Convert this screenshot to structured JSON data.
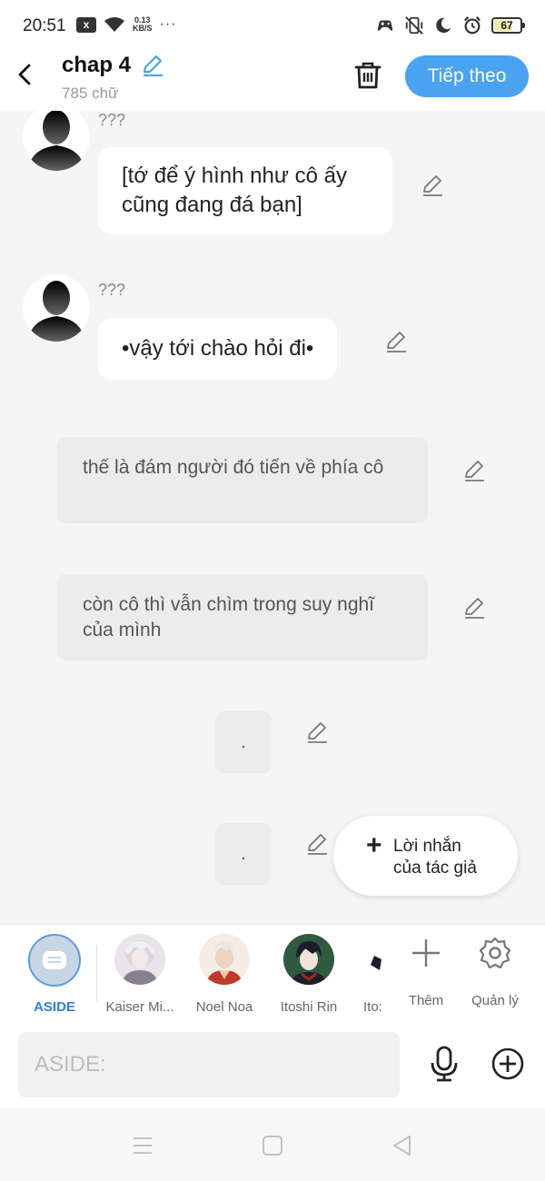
{
  "status_bar": {
    "time": "20:51",
    "notification_badge": "x",
    "net_speed_value": "0.13",
    "net_speed_unit": "KB/S",
    "more_dots": "···",
    "battery": "67"
  },
  "header": {
    "title": "chap 4",
    "word_count": "785 chữ",
    "next_label": "Tiếp theo"
  },
  "messages": [
    {
      "type": "character",
      "speaker": "???",
      "text": "[tớ để ý hình như cô ấy cũng đang đá bạn]"
    },
    {
      "type": "character",
      "speaker": "???",
      "text": "•vậy tới chào hỏi đi•"
    },
    {
      "type": "narration",
      "text": "thế là đám người đó tiến về phía cô"
    },
    {
      "type": "narration",
      "text": "còn cô thì vẫn chìm trong suy nghĩ của mình"
    },
    {
      "type": "narration",
      "text": "."
    },
    {
      "type": "narration",
      "text": "."
    }
  ],
  "fab": {
    "label": "Lời nhắn của tác giả"
  },
  "characters": [
    {
      "name": "ASIDE",
      "selected": true
    },
    {
      "name": "Kaiser Mi...",
      "avatar_colors": [
        "#d9d6dc",
        "#8a7f8f"
      ]
    },
    {
      "name": "Noel Noa",
      "avatar_colors": [
        "#ecd3c2",
        "#c0392b"
      ]
    },
    {
      "name": "Itoshi Rin",
      "avatar_colors": [
        "#2e5b3f",
        "#1a1f2b"
      ]
    },
    {
      "name": "Ito:"
    }
  ],
  "tools": {
    "add_label": "Thêm",
    "manage_label": "Quản lý"
  },
  "input": {
    "placeholder": "ASIDE:"
  },
  "colors": {
    "accent": "#4aa3f0",
    "aside_selected": "#2d7fe0",
    "bubble_grey": "#ececec"
  }
}
